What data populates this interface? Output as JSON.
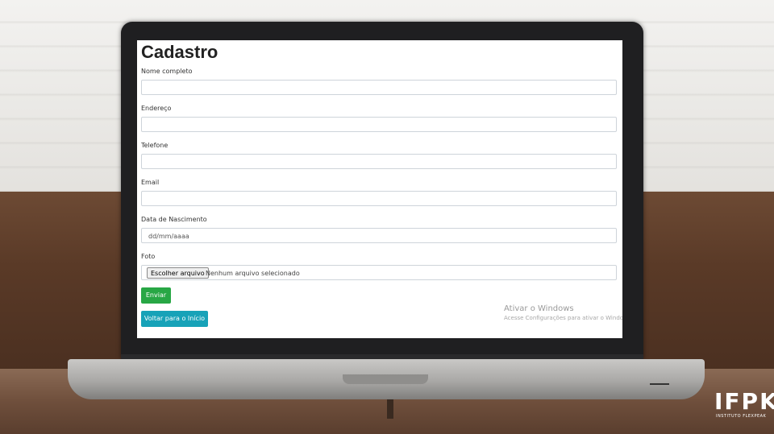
{
  "form": {
    "title": "Cadastro",
    "fields": [
      {
        "label": "Nome completo",
        "value": ""
      },
      {
        "label": "Endereço",
        "value": ""
      },
      {
        "label": "Telefone",
        "value": ""
      },
      {
        "label": "Email",
        "value": ""
      },
      {
        "label": "Data de Nascimento",
        "placeholder": "dd/mm/aaaa"
      },
      {
        "label": "Foto"
      }
    ],
    "file": {
      "button_label": "Escolher arquivo",
      "status": "Nenhum arquivo selecionado"
    },
    "submit_label": "Enviar",
    "back_label": "Voltar para o Início"
  },
  "watermark": {
    "title": "Ativar o Windows",
    "subtitle": "Acesse Configurações para ativar o Windows."
  },
  "logo": {
    "letters": "IFPK",
    "subtitle": "INSTITUTO FLEXPEAK"
  },
  "colors": {
    "submit": "#28a745",
    "back": "#17a2b8"
  }
}
